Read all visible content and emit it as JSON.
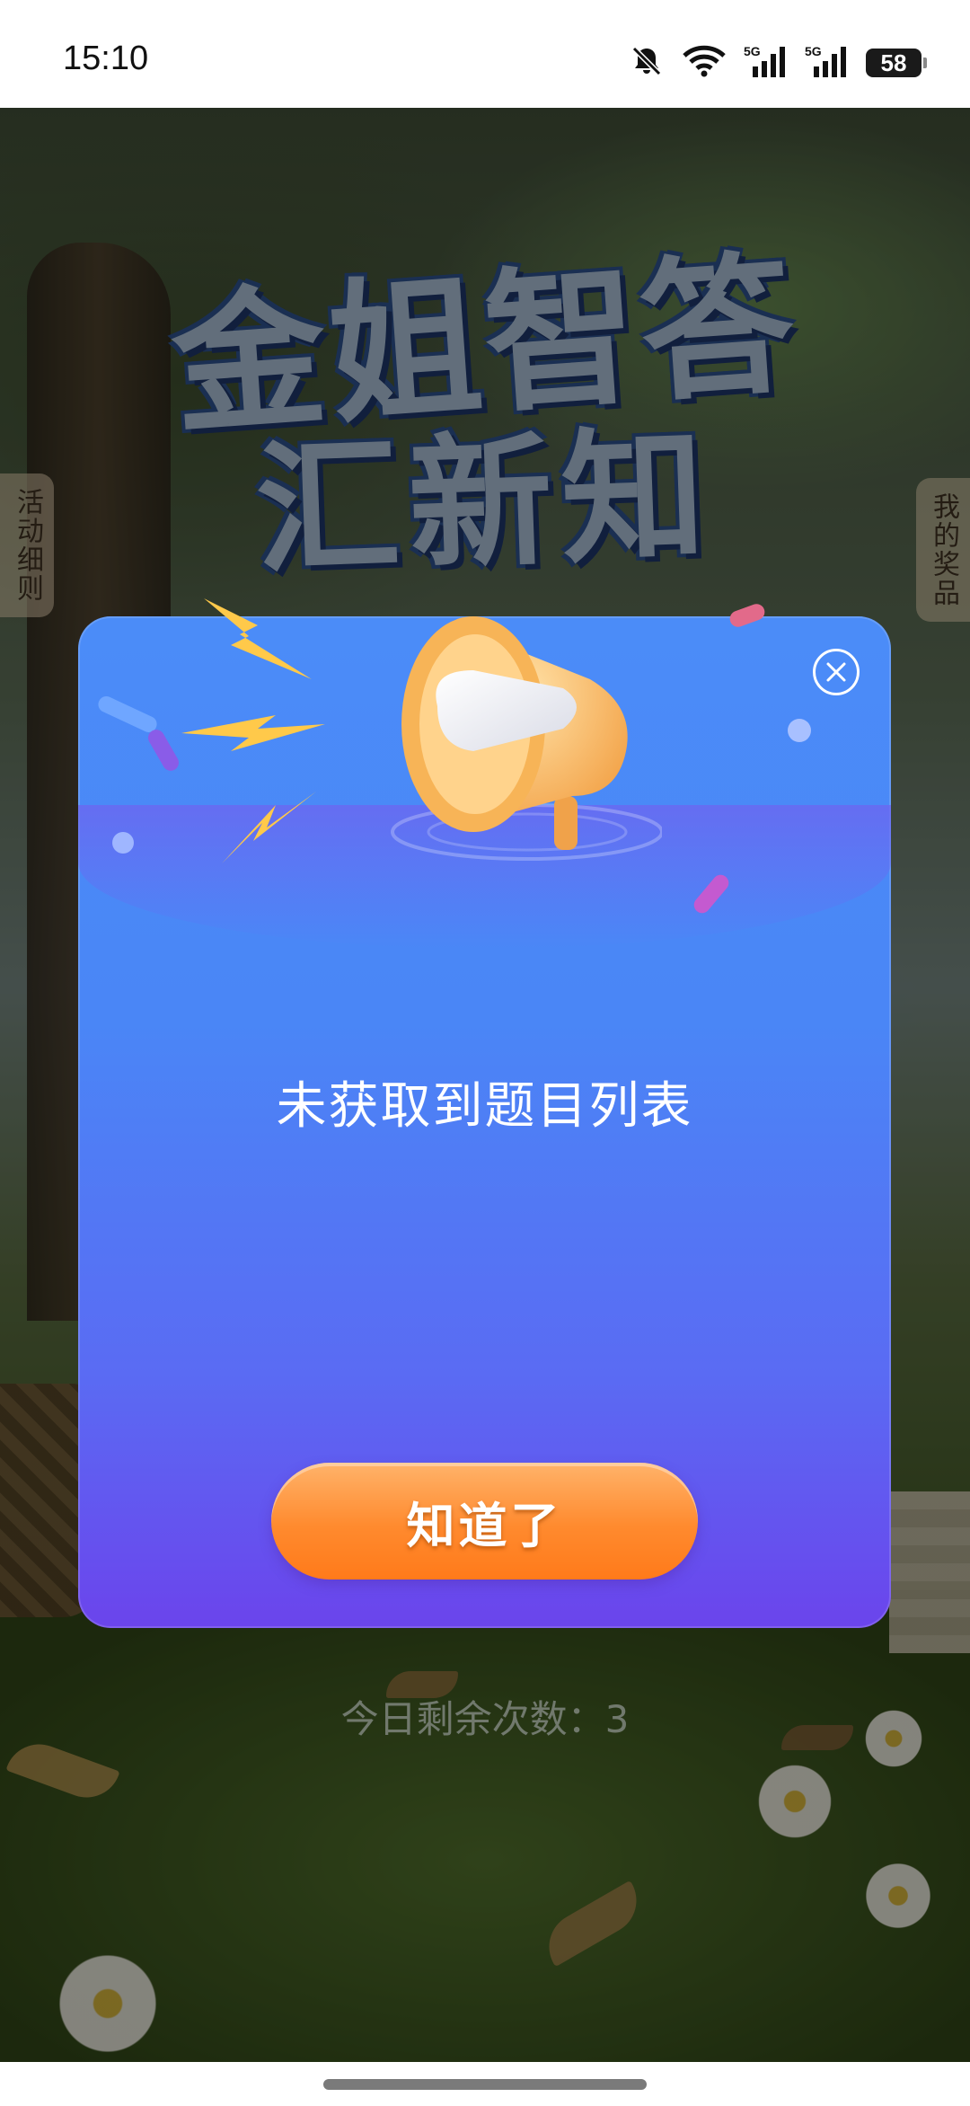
{
  "status_bar": {
    "time": "15:10",
    "battery_level": "58",
    "icons": [
      "bell-muted-icon",
      "wifi-icon",
      "signal-5g-icon",
      "signal-5g-icon",
      "battery-icon"
    ]
  },
  "page": {
    "title_line1": "金姐智答",
    "title_line2": "汇新知",
    "left_tab": "活动细则",
    "right_tab": "我的奖品",
    "remaining_attempts": "今日剩余次数：3"
  },
  "dialog": {
    "message": "未获取到题目列表",
    "confirm_label": "知道了",
    "close_icon": "close-icon",
    "illustration": "megaphone-icon",
    "colors": {
      "top": "#4b8cf8",
      "bottom": "#6b44ec",
      "button": "#ff8a2e"
    }
  }
}
